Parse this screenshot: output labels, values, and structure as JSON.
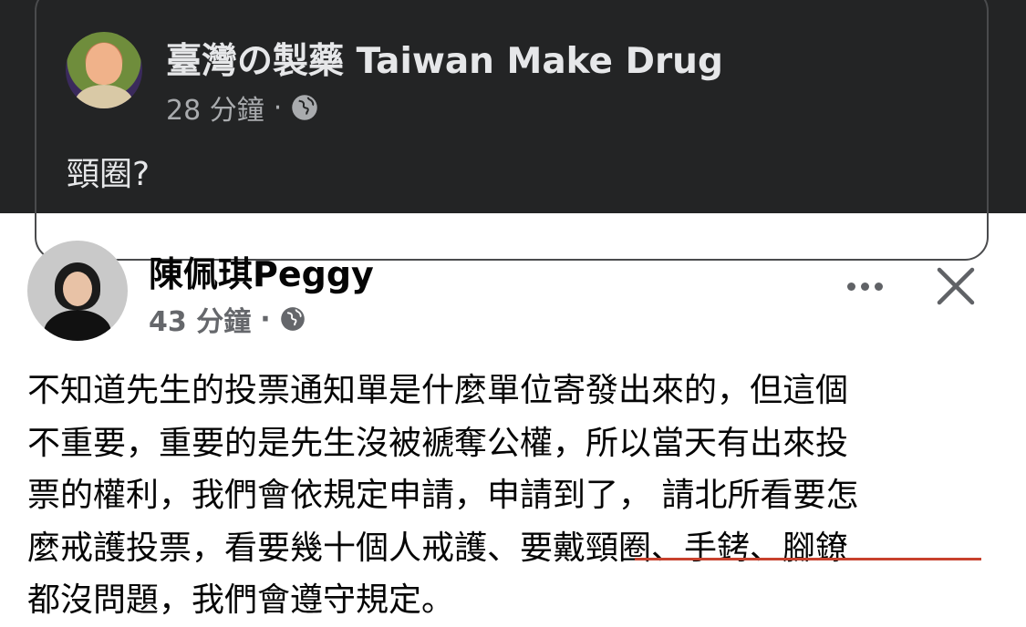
{
  "shared_post": {
    "author": "臺灣の製藥 Taiwan Make Drug",
    "time": "28 分鐘",
    "separator": "·",
    "privacy_icon": "globe-icon",
    "body": "頸圈?"
  },
  "main_post": {
    "author": "陳佩琪Peggy",
    "time": "43 分鐘",
    "separator": "·",
    "privacy_icon": "globe-icon",
    "more_icon": "more-horizontal-icon",
    "close_icon": "close-icon",
    "lines": [
      "不知道先生的投票通知單是什麼單位寄發出來的，但這個",
      "不重要，重要的是先生沒被褫奪公權，所以當天有出來投",
      "票的權利，我們會依規定申請，申請到了， 請北所看要怎",
      "麼戒護投票，看要幾十個人戒護、要戴頸圈、手銬、腳鐐",
      "都沒問題，我們會遵守規定。"
    ],
    "underline_color": "#c8412d"
  },
  "colors": {
    "dark_bg": "#232425",
    "light_bg": "#ffffff",
    "meta_gray": "#65676b"
  }
}
